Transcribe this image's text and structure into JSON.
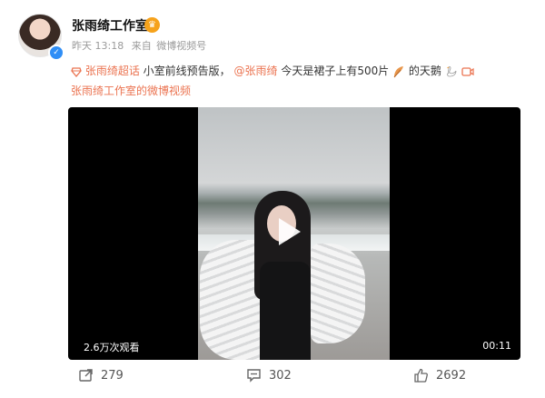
{
  "post": {
    "author": "张雨绮工作室",
    "time": "昨天 13:18",
    "source_prefix": "来自",
    "source": "微博视频号",
    "super_topic": "张雨绮超话",
    "text_part1": " 小室前线预告版，",
    "mention": "@张雨绮",
    "text_part2": " 今天是裙子上有500片",
    "text_part3": " 的天鹅",
    "video_link": "张雨绮工作室的微博视频"
  },
  "video": {
    "views": "2.6万次观看",
    "duration": "00:11"
  },
  "actions": {
    "reposts": "279",
    "comments": "302",
    "likes": "2692"
  },
  "colors": {
    "link": "#eb7350",
    "verified": "#2f8ef6",
    "vip": "#f6a21b"
  },
  "icons": {
    "super_topic": "diamond-icon",
    "feather": "feather-icon",
    "swan": "swan-icon",
    "video": "video-icon",
    "repost": "repost-icon",
    "comment": "comment-icon",
    "like": "thumb-up-icon",
    "play": "play-icon"
  }
}
